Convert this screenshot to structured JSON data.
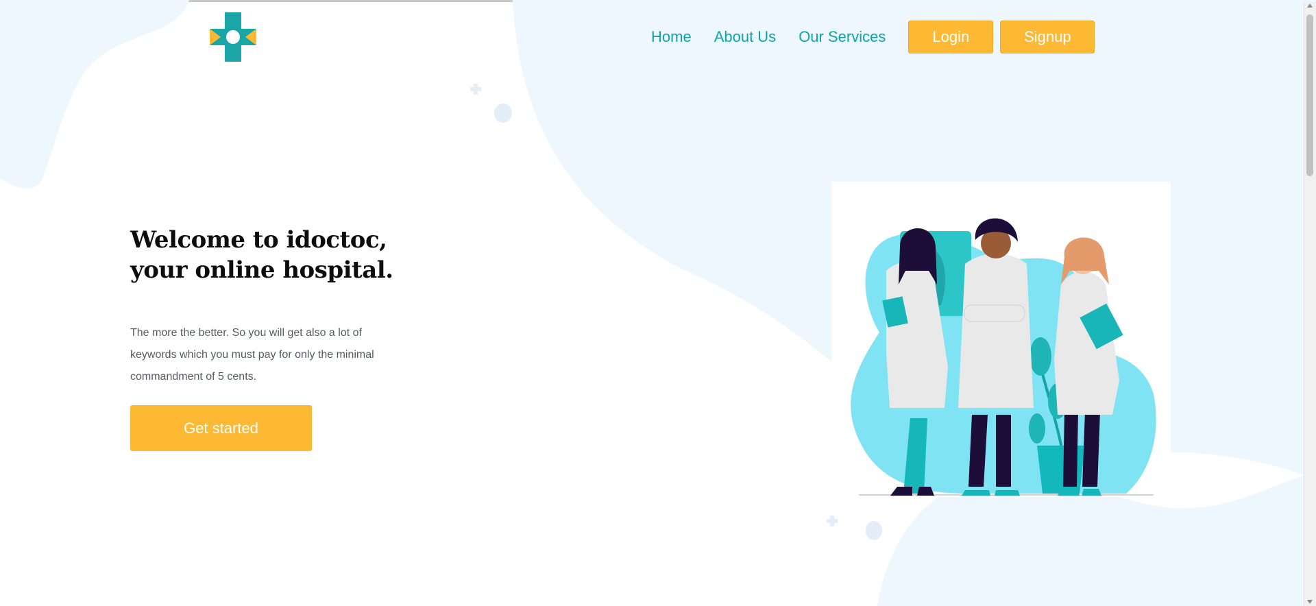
{
  "colors": {
    "accent": "#fdb834",
    "brand": "#0ea5a9",
    "blob": "#eef6fe",
    "illustration_blob": "#7fe3f4"
  },
  "logo": {
    "icon": "medical-cross-icon"
  },
  "nav": {
    "links": [
      "Home",
      "About Us",
      "Our Services"
    ],
    "login_label": "Login",
    "signup_label": "Signup"
  },
  "hero": {
    "title_line1": "Welcome to idoctoc,",
    "title_line2": "your online hospital.",
    "description": "The more the better. So you will get also a lot of keywords which you must pay for only the minimal commandment of 5 cents.",
    "cta_label": "Get started"
  },
  "illustration": {
    "icon": "doctors-illustration"
  }
}
